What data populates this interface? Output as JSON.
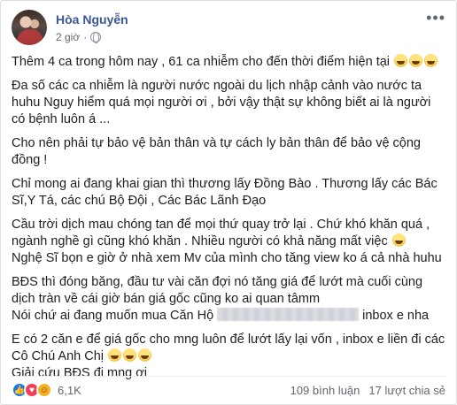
{
  "post": {
    "author": "Hòa Nguyễn",
    "time": "2 giờ",
    "more_icon": "ellipsis-icon",
    "privacy_icon": "globe-icon"
  },
  "content": {
    "p1": "Thêm 4 ca trong hôm nay , 61 ca nhiễm cho đến thời điểm hiện tại",
    "p2": "Đa số các ca nhiễm là người nước ngoài du lịch nhập cảnh vào nước ta huhu Nguy hiểm quá mọi người ơi , bởi vậy thật sự không biết ai là người có bệnh luôn á ...",
    "p3": "Cho nên phải tự bảo vệ bản thân và tự cách ly bản thân để bảo vệ cộng đồng !",
    "p4": "Chỉ mong ai đang khai gian thì thương lấy Đồng Bào . Thương lấy các Bác Sĩ,Y Tá, các chú Bộ Đội , Các Bác Lãnh Đạo",
    "p5": "Cầu trời dịch mau chóng tan để mọi thứ quay trở lại . Chứ khó khăn quá , ngành nghề gì cũng khó khăn . Nhiều người có khả năng mất việc",
    "p6": "Nghệ Sĩ bọn e giờ ở nhà xem Mv của mình cho tăng view ko á cả nhà huhu",
    "p7": "BĐS thì đóng băng, đầu tư vài căn đợi nó tăng giá để lướt mà cuối cùng dịch tràn về cái giờ bán giá gốc cũng ko ai quan tâmm",
    "p8a": "Nói chứ ai đang muốn mua Căn Hộ",
    "p8b": "inbox e nha",
    "p9": "E có 2 căn e để giá gốc cho mng luôn để lướt lấy lại vốn , inbox e liền đi các Cô Chú Anh Chị",
    "p10": "Giải cứu BĐS đi mng ơi"
  },
  "footer": {
    "reactions_count": "6,1K",
    "comments": "109 bình luận",
    "shares": "17 lượt chia sẻ",
    "reaction_icons": [
      "like-icon",
      "love-icon",
      "haha-icon"
    ]
  }
}
